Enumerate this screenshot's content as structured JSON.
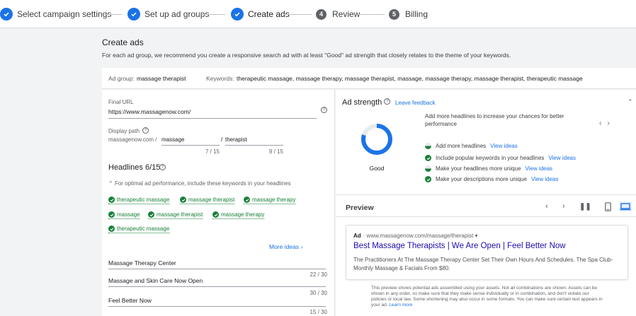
{
  "stepper": {
    "steps": [
      {
        "label": "Select campaign settings",
        "state": "done"
      },
      {
        "label": "Set up ad groups",
        "state": "done"
      },
      {
        "label": "Create ads",
        "state": "active"
      },
      {
        "label": "Review",
        "number": "4",
        "state": "pending"
      },
      {
        "label": "Billing",
        "number": "5",
        "state": "pending"
      }
    ]
  },
  "page": {
    "title": "Create ads",
    "description": "For each ad group, we recommend you create a responsive search ad with at least \"Good\" ad strength that closely relates to the theme of your keywords."
  },
  "ad_group": {
    "label": "Ad group:",
    "value": "massage therapist",
    "keywords_label": "Keywords:",
    "keywords_value": "therapeutic massage, massage therapy, massage therapist, massage, massage therapy, massage therapist, therapeutic massage"
  },
  "editor": {
    "final_url_label": "Final URL",
    "final_url_value": "https://www.massagenow.com/",
    "display_path_label": "Display path",
    "display_path_domain": "massagenow.com /",
    "path1": "massage",
    "path_sep": "/",
    "path2": "therapist",
    "path1_count": "7 / 15",
    "path2_count": "9 / 15",
    "headlines_title": "Headlines 6/15",
    "tip": "For optimal ad performance, include these keywords in your headlines",
    "keywords": [
      "therapeutic massage",
      "massage therapist",
      "massage therapy",
      "massage",
      "massage therapist",
      "massage therapy",
      "therapeutic massage"
    ],
    "more_ideas": "More ideas",
    "headlines": [
      {
        "text": "Massage Therapy Center",
        "count": "22 / 30"
      },
      {
        "text": "Massage and Skin Care Now Open",
        "count": "30 / 30"
      },
      {
        "text": "Feel Better Now",
        "count": "15 / 30"
      }
    ]
  },
  "strength": {
    "title": "Ad strength",
    "leave_feedback": "Leave feedback",
    "rating": "Good",
    "rating_fraction": 0.8,
    "main_tip": "Add more headlines to increase your chances for better performance",
    "suggestions": [
      {
        "text": "Add more headlines",
        "link": "View ideas",
        "status": "partial"
      },
      {
        "text": "Include popular keywords in your headlines",
        "link": "View ideas",
        "status": "done"
      },
      {
        "text": "Make your headlines more unique",
        "link": "View ideas",
        "status": "partial"
      },
      {
        "text": "Make your descriptions more unique",
        "link": "View ideas",
        "status": "done"
      }
    ],
    "colors": {
      "ring": "#1a73e8",
      "track": "#e8eaed",
      "done": "#188038"
    }
  },
  "preview": {
    "title": "Preview",
    "ad_label": "Ad",
    "ad_url": "· www.massagenow.com/massage/therapist ▾",
    "ad_headline": "Best Massage Therapists | We Are Open | Feel Better Now",
    "ad_description": "The Practitioners At The Massage Therapy Center Set Their Own Hours And Schedules. The Spa Club-Monthly Massage & Facials From $80.",
    "disclaimer": "This preview shows potential ads assembled using your assets. Not all combinations are shown. Assets can be shown in any order, so make sure that they make sense individually or in combination, and don't violate our policies or local law. Some shortening may also occur in some formats. You can make sure certain text appears in your ad.",
    "learn_more": "Learn more"
  },
  "icons": {
    "check": "check-icon",
    "help": "help-circle-icon",
    "chevron_up": "chevron-up-icon",
    "chevron_left": "chevron-left-icon",
    "chevron_right": "chevron-right-icon",
    "pause": "pause-icon",
    "mobile": "mobile-icon",
    "desktop": "desktop-icon"
  }
}
